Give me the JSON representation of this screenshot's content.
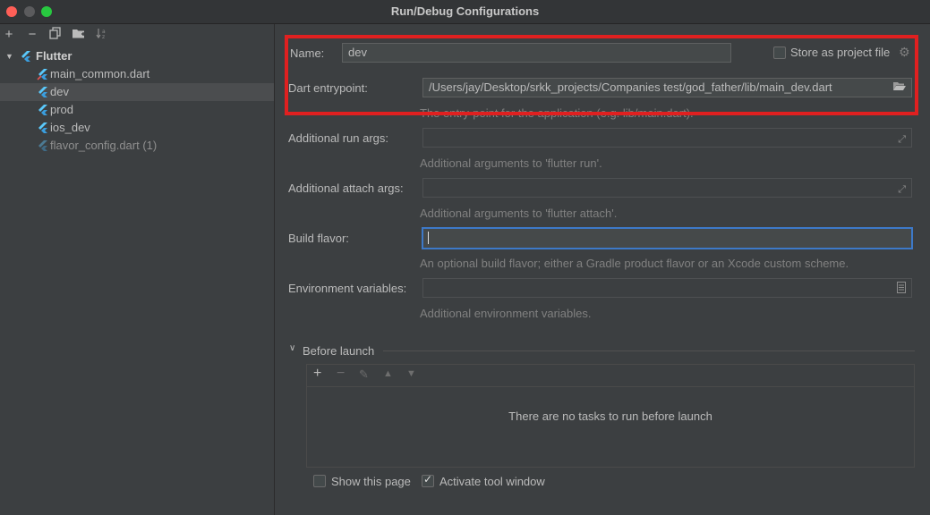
{
  "window": {
    "title": "Run/Debug Configurations"
  },
  "sidebar": {
    "toolbar_icons": [
      "add-icon",
      "remove-icon",
      "copy-icon",
      "folder-add-icon",
      "sort-icon"
    ],
    "group": {
      "label": "Flutter"
    },
    "items": [
      {
        "label": "main_common.dart"
      },
      {
        "label": "dev"
      },
      {
        "label": "prod"
      },
      {
        "label": "ios_dev"
      },
      {
        "label": "flavor_config.dart (1)"
      }
    ]
  },
  "form": {
    "name": {
      "label": "Name:",
      "value": "dev"
    },
    "store_as_project_file": {
      "label": "Store as project file",
      "checked": false
    },
    "dart_entrypoint": {
      "label": "Dart entrypoint:",
      "value": "/Users/jay/Desktop/srkk_projects/Companies test/god_father/lib/main_dev.dart",
      "hint": "The entry-point for the application (e.g. lib/main.dart)."
    },
    "run_args": {
      "label": "Additional run args:",
      "value": "",
      "hint": "Additional arguments to 'flutter run'."
    },
    "attach_args": {
      "label": "Additional attach args:",
      "value": "",
      "hint": "Additional arguments to 'flutter attach'."
    },
    "build_flavor": {
      "label": "Build flavor:",
      "value": "",
      "hint": "An optional build flavor; either a Gradle product flavor or an Xcode custom scheme."
    },
    "env_vars": {
      "label": "Environment variables:",
      "value": "",
      "hint": "Additional environment variables."
    }
  },
  "before_launch": {
    "title": "Before launch",
    "empty_message": "There are no tasks to run before launch"
  },
  "footer": {
    "show_this_page": {
      "label": "Show this page",
      "checked": false
    },
    "activate_tool_window": {
      "label": "Activate tool window",
      "checked": true
    }
  },
  "colors": {
    "highlight_box": "#e02020",
    "focus": "#3d79c8",
    "selection": "#4b4d4f"
  }
}
